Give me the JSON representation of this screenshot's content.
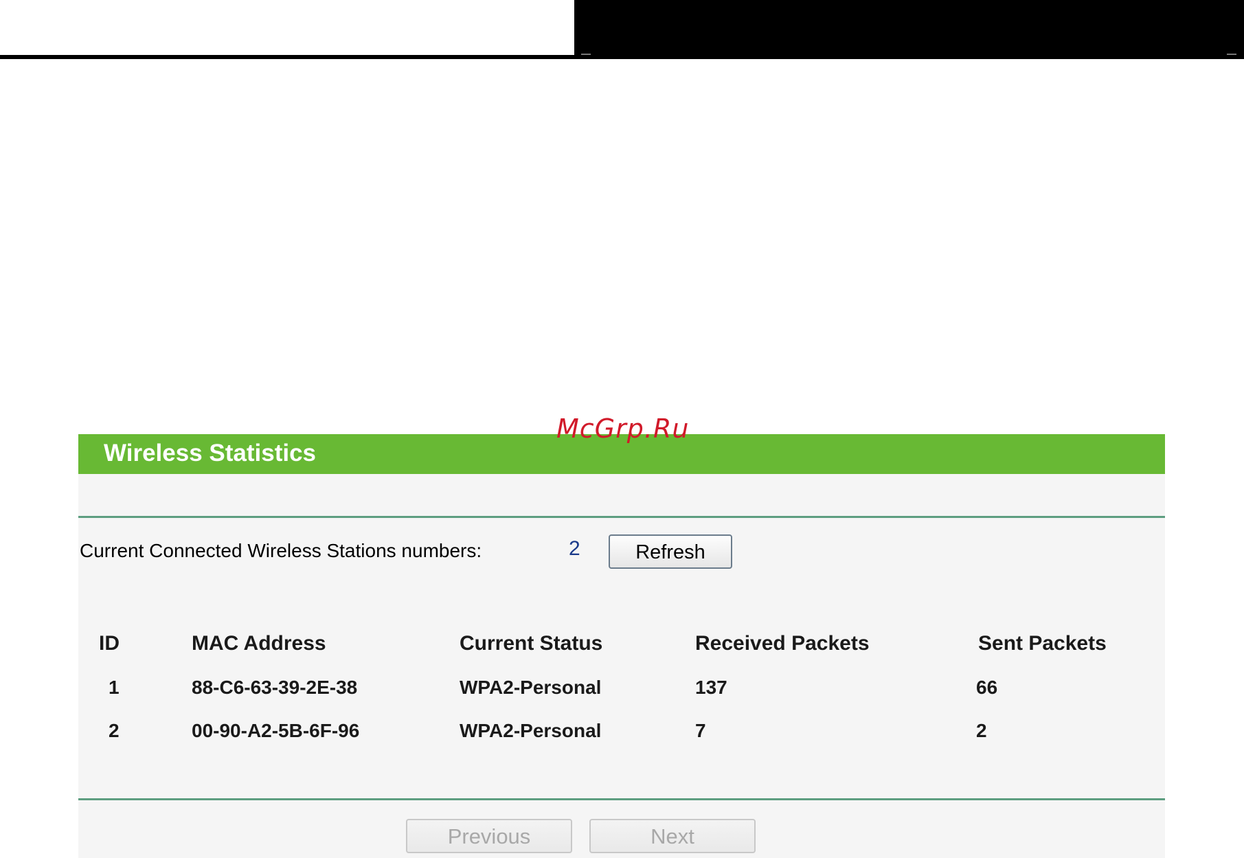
{
  "watermark": "McGrp.Ru",
  "panel": {
    "title": "Wireless Statistics",
    "stations_label": "Current Connected Wireless Stations numbers:",
    "stations_count": "2",
    "refresh_label": "Refresh"
  },
  "table": {
    "headers": [
      "ID",
      "MAC Address",
      "Current Status",
      "Received Packets",
      "Sent Packets"
    ],
    "rows": [
      [
        "1",
        "88-C6-63-39-2E-38",
        "WPA2-Personal",
        "137",
        "66"
      ],
      [
        "2",
        "00-90-A2-5B-6F-96",
        "WPA2-Personal",
        "7",
        "2"
      ]
    ]
  },
  "pagination": {
    "previous_label": "Previous",
    "next_label": "Next"
  },
  "colors": {
    "header_green": "#68b934",
    "rule_teal": "#5d9e80",
    "count_blue": "#1a3a8a",
    "watermark_red": "#d11a2a"
  }
}
